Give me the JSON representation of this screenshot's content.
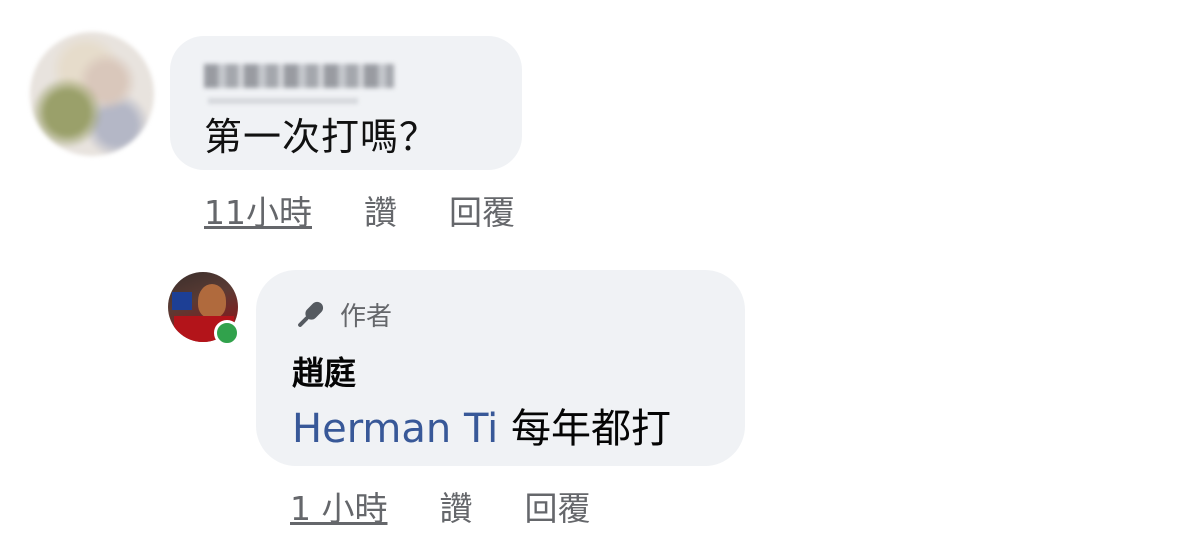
{
  "comment1": {
    "avatar_alt": "blurred avatar",
    "author_name": "Herman Ti",
    "text": "第一次打嗎？",
    "time": "11小時",
    "like": "讚",
    "reply": "回覆"
  },
  "comment2": {
    "badge_icon": "microphone-icon",
    "badge_label": "作者",
    "author_name": "趙庭",
    "mention": "Herman Ti",
    "text": "每年都打",
    "time": "1 小時",
    "like": "讚",
    "reply": "回覆",
    "online_color": "#31a24c"
  },
  "colors": {
    "bubble": "#f0f2f5",
    "meta": "#65676b",
    "mention": "#385898"
  }
}
